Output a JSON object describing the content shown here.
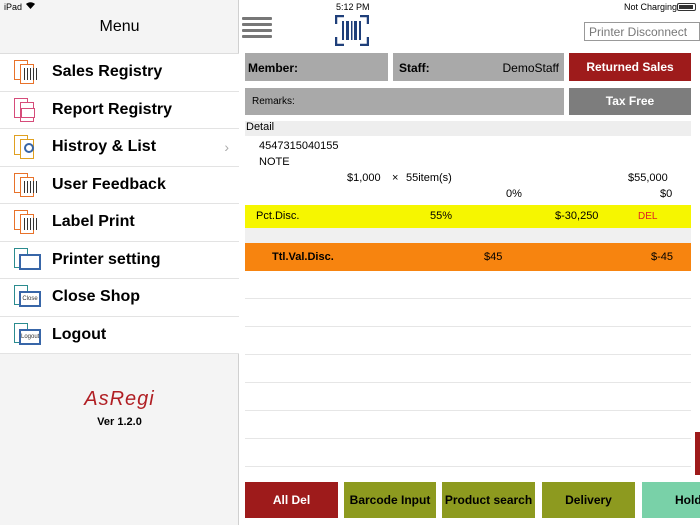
{
  "status_bar": {
    "device": "iPad",
    "wifi": "wifi-icon",
    "time": "5:12 PM",
    "charging": "Not Charging"
  },
  "sidebar": {
    "title": "Menu",
    "items": [
      {
        "label": "Sales Registry",
        "icon": "sales-registry-icon",
        "chevron": false
      },
      {
        "label": "Report Registry",
        "icon": "report-registry-icon",
        "chevron": false
      },
      {
        "label": "Histroy & List",
        "icon": "history-list-icon",
        "chevron": true
      },
      {
        "label": "User Feedback",
        "icon": "user-feedback-icon",
        "chevron": false
      },
      {
        "label": "Label Print",
        "icon": "label-print-icon",
        "chevron": false
      },
      {
        "label": "Printer setting",
        "icon": "printer-setting-icon",
        "chevron": false
      },
      {
        "label": "Close Shop",
        "icon": "close-shop-icon",
        "chevron": false
      },
      {
        "label": "Logout",
        "icon": "logout-icon",
        "chevron": false
      }
    ],
    "logo": "AsRegi",
    "version": "Ver 1.2.0",
    "close_badge": "Close",
    "logout_badge": "Logout"
  },
  "header": {
    "printer_status": "Printer Disconnect"
  },
  "fields": {
    "member_label": "Member:",
    "staff_label": "Staff:",
    "staff_value": "DemoStaff",
    "returned_sales": "Returned Sales",
    "remarks_label": "Remarks:",
    "tax_free": "Tax Free"
  },
  "detail": {
    "header": "Detail",
    "item_code": "4547315040155",
    "item_name": "NOTE",
    "unit_price": "$1,000",
    "times": "×",
    "quantity": "55item(s)",
    "line_total": "$55,000",
    "tax_rate": "0%",
    "tax_amount": "$0"
  },
  "pct_disc": {
    "label": "Pct.Disc.",
    "rate": "55%",
    "amount": "$-30,250",
    "del": "DEL"
  },
  "ttl_disc": {
    "label": "Ttl.Val.Disc.",
    "value": "$45",
    "amount": "$-45"
  },
  "bottom_buttons": {
    "all_del": "All Del",
    "barcode_input": "Barcode Input",
    "product_search": "Product search",
    "delivery": "Delivery",
    "hold": "Hold"
  },
  "colors": {
    "red": "#9e1b1b",
    "olive": "#8d9a1f",
    "teal": "#79d1a8",
    "yellow_row": "#f6f600",
    "orange_row": "#f7840f"
  }
}
